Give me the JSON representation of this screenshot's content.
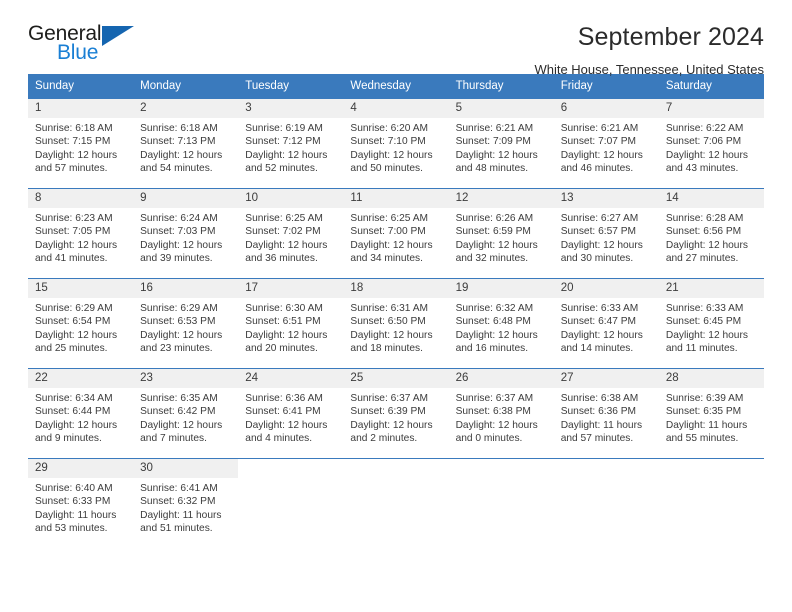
{
  "brand": {
    "name_top": "General",
    "name_bottom": "Blue"
  },
  "header": {
    "title": "September 2024",
    "location": "White House, Tennessee, United States"
  },
  "calendar": {
    "weekday_headers": [
      "Sunday",
      "Monday",
      "Tuesday",
      "Wednesday",
      "Thursday",
      "Friday",
      "Saturday"
    ],
    "colors": {
      "header_background": "#3a7abd",
      "header_text": "#ffffff",
      "daynumber_background": "#f0f0f0",
      "cell_background": "#ffffff",
      "row_divider": "#3a7abd",
      "brand_blue": "#1a7fd4"
    },
    "weeks": [
      [
        {
          "day": "1",
          "sunrise": "Sunrise: 6:18 AM",
          "sunset": "Sunset: 7:15 PM",
          "daylight1": "Daylight: 12 hours",
          "daylight2": "and 57 minutes."
        },
        {
          "day": "2",
          "sunrise": "Sunrise: 6:18 AM",
          "sunset": "Sunset: 7:13 PM",
          "daylight1": "Daylight: 12 hours",
          "daylight2": "and 54 minutes."
        },
        {
          "day": "3",
          "sunrise": "Sunrise: 6:19 AM",
          "sunset": "Sunset: 7:12 PM",
          "daylight1": "Daylight: 12 hours",
          "daylight2": "and 52 minutes."
        },
        {
          "day": "4",
          "sunrise": "Sunrise: 6:20 AM",
          "sunset": "Sunset: 7:10 PM",
          "daylight1": "Daylight: 12 hours",
          "daylight2": "and 50 minutes."
        },
        {
          "day": "5",
          "sunrise": "Sunrise: 6:21 AM",
          "sunset": "Sunset: 7:09 PM",
          "daylight1": "Daylight: 12 hours",
          "daylight2": "and 48 minutes."
        },
        {
          "day": "6",
          "sunrise": "Sunrise: 6:21 AM",
          "sunset": "Sunset: 7:07 PM",
          "daylight1": "Daylight: 12 hours",
          "daylight2": "and 46 minutes."
        },
        {
          "day": "7",
          "sunrise": "Sunrise: 6:22 AM",
          "sunset": "Sunset: 7:06 PM",
          "daylight1": "Daylight: 12 hours",
          "daylight2": "and 43 minutes."
        }
      ],
      [
        {
          "day": "8",
          "sunrise": "Sunrise: 6:23 AM",
          "sunset": "Sunset: 7:05 PM",
          "daylight1": "Daylight: 12 hours",
          "daylight2": "and 41 minutes."
        },
        {
          "day": "9",
          "sunrise": "Sunrise: 6:24 AM",
          "sunset": "Sunset: 7:03 PM",
          "daylight1": "Daylight: 12 hours",
          "daylight2": "and 39 minutes."
        },
        {
          "day": "10",
          "sunrise": "Sunrise: 6:25 AM",
          "sunset": "Sunset: 7:02 PM",
          "daylight1": "Daylight: 12 hours",
          "daylight2": "and 36 minutes."
        },
        {
          "day": "11",
          "sunrise": "Sunrise: 6:25 AM",
          "sunset": "Sunset: 7:00 PM",
          "daylight1": "Daylight: 12 hours",
          "daylight2": "and 34 minutes."
        },
        {
          "day": "12",
          "sunrise": "Sunrise: 6:26 AM",
          "sunset": "Sunset: 6:59 PM",
          "daylight1": "Daylight: 12 hours",
          "daylight2": "and 32 minutes."
        },
        {
          "day": "13",
          "sunrise": "Sunrise: 6:27 AM",
          "sunset": "Sunset: 6:57 PM",
          "daylight1": "Daylight: 12 hours",
          "daylight2": "and 30 minutes."
        },
        {
          "day": "14",
          "sunrise": "Sunrise: 6:28 AM",
          "sunset": "Sunset: 6:56 PM",
          "daylight1": "Daylight: 12 hours",
          "daylight2": "and 27 minutes."
        }
      ],
      [
        {
          "day": "15",
          "sunrise": "Sunrise: 6:29 AM",
          "sunset": "Sunset: 6:54 PM",
          "daylight1": "Daylight: 12 hours",
          "daylight2": "and 25 minutes."
        },
        {
          "day": "16",
          "sunrise": "Sunrise: 6:29 AM",
          "sunset": "Sunset: 6:53 PM",
          "daylight1": "Daylight: 12 hours",
          "daylight2": "and 23 minutes."
        },
        {
          "day": "17",
          "sunrise": "Sunrise: 6:30 AM",
          "sunset": "Sunset: 6:51 PM",
          "daylight1": "Daylight: 12 hours",
          "daylight2": "and 20 minutes."
        },
        {
          "day": "18",
          "sunrise": "Sunrise: 6:31 AM",
          "sunset": "Sunset: 6:50 PM",
          "daylight1": "Daylight: 12 hours",
          "daylight2": "and 18 minutes."
        },
        {
          "day": "19",
          "sunrise": "Sunrise: 6:32 AM",
          "sunset": "Sunset: 6:48 PM",
          "daylight1": "Daylight: 12 hours",
          "daylight2": "and 16 minutes."
        },
        {
          "day": "20",
          "sunrise": "Sunrise: 6:33 AM",
          "sunset": "Sunset: 6:47 PM",
          "daylight1": "Daylight: 12 hours",
          "daylight2": "and 14 minutes."
        },
        {
          "day": "21",
          "sunrise": "Sunrise: 6:33 AM",
          "sunset": "Sunset: 6:45 PM",
          "daylight1": "Daylight: 12 hours",
          "daylight2": "and 11 minutes."
        }
      ],
      [
        {
          "day": "22",
          "sunrise": "Sunrise: 6:34 AM",
          "sunset": "Sunset: 6:44 PM",
          "daylight1": "Daylight: 12 hours",
          "daylight2": "and 9 minutes."
        },
        {
          "day": "23",
          "sunrise": "Sunrise: 6:35 AM",
          "sunset": "Sunset: 6:42 PM",
          "daylight1": "Daylight: 12 hours",
          "daylight2": "and 7 minutes."
        },
        {
          "day": "24",
          "sunrise": "Sunrise: 6:36 AM",
          "sunset": "Sunset: 6:41 PM",
          "daylight1": "Daylight: 12 hours",
          "daylight2": "and 4 minutes."
        },
        {
          "day": "25",
          "sunrise": "Sunrise: 6:37 AM",
          "sunset": "Sunset: 6:39 PM",
          "daylight1": "Daylight: 12 hours",
          "daylight2": "and 2 minutes."
        },
        {
          "day": "26",
          "sunrise": "Sunrise: 6:37 AM",
          "sunset": "Sunset: 6:38 PM",
          "daylight1": "Daylight: 12 hours",
          "daylight2": "and 0 minutes."
        },
        {
          "day": "27",
          "sunrise": "Sunrise: 6:38 AM",
          "sunset": "Sunset: 6:36 PM",
          "daylight1": "Daylight: 11 hours",
          "daylight2": "and 57 minutes."
        },
        {
          "day": "28",
          "sunrise": "Sunrise: 6:39 AM",
          "sunset": "Sunset: 6:35 PM",
          "daylight1": "Daylight: 11 hours",
          "daylight2": "and 55 minutes."
        }
      ],
      [
        {
          "day": "29",
          "sunrise": "Sunrise: 6:40 AM",
          "sunset": "Sunset: 6:33 PM",
          "daylight1": "Daylight: 11 hours",
          "daylight2": "and 53 minutes."
        },
        {
          "day": "30",
          "sunrise": "Sunrise: 6:41 AM",
          "sunset": "Sunset: 6:32 PM",
          "daylight1": "Daylight: 11 hours",
          "daylight2": "and 51 minutes."
        },
        {
          "day": "",
          "sunrise": "",
          "sunset": "",
          "daylight1": "",
          "daylight2": ""
        },
        {
          "day": "",
          "sunrise": "",
          "sunset": "",
          "daylight1": "",
          "daylight2": ""
        },
        {
          "day": "",
          "sunrise": "",
          "sunset": "",
          "daylight1": "",
          "daylight2": ""
        },
        {
          "day": "",
          "sunrise": "",
          "sunset": "",
          "daylight1": "",
          "daylight2": ""
        },
        {
          "day": "",
          "sunrise": "",
          "sunset": "",
          "daylight1": "",
          "daylight2": ""
        }
      ]
    ]
  }
}
